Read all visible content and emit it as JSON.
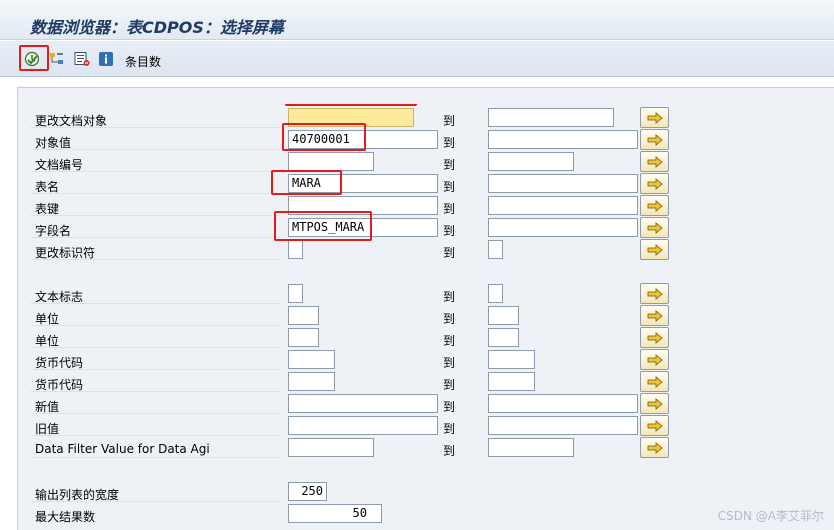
{
  "title": "数据浏览器：表CDPOS：选择屏幕",
  "toolbar": {
    "buttons": [
      "execute-icon",
      "hierarchy-icon",
      "variant-icon",
      "info-icon"
    ],
    "entries_label": "条目数"
  },
  "to_label": "到",
  "rows": [
    {
      "label": "更改文档对象",
      "from": "",
      "to": ""
    },
    {
      "label": "对象值",
      "from": "40700001",
      "to": ""
    },
    {
      "label": "文档编号",
      "from": "",
      "to": ""
    },
    {
      "label": "表名",
      "from": "MARA",
      "to": ""
    },
    {
      "label": "表键",
      "from": "",
      "to": ""
    },
    {
      "label": "字段名",
      "from": "MTPOS_MARA",
      "to": ""
    },
    {
      "label": "更改标识符",
      "from": "",
      "to": ""
    },
    {
      "label": "文本标志",
      "from": "",
      "to": ""
    },
    {
      "label": "单位",
      "from": "",
      "to": ""
    },
    {
      "label": "单位",
      "from": "",
      "to": ""
    },
    {
      "label": "货币代码",
      "from": "",
      "to": ""
    },
    {
      "label": "货币代码",
      "from": "",
      "to": ""
    },
    {
      "label": "新值",
      "from": "",
      "to": ""
    },
    {
      "label": "旧值",
      "from": "",
      "to": ""
    },
    {
      "label": "Data Filter Value for Data Agi",
      "from": "",
      "to": ""
    }
  ],
  "output_width": {
    "label": "输出列表的宽度",
    "value": "250"
  },
  "max_hits": {
    "label": "最大结果数",
    "value": "50"
  },
  "watermark": "CSDN @A李艾菲尔",
  "colors": {
    "highlight": "#e41b1b",
    "required_field": "#fdeb9c"
  }
}
